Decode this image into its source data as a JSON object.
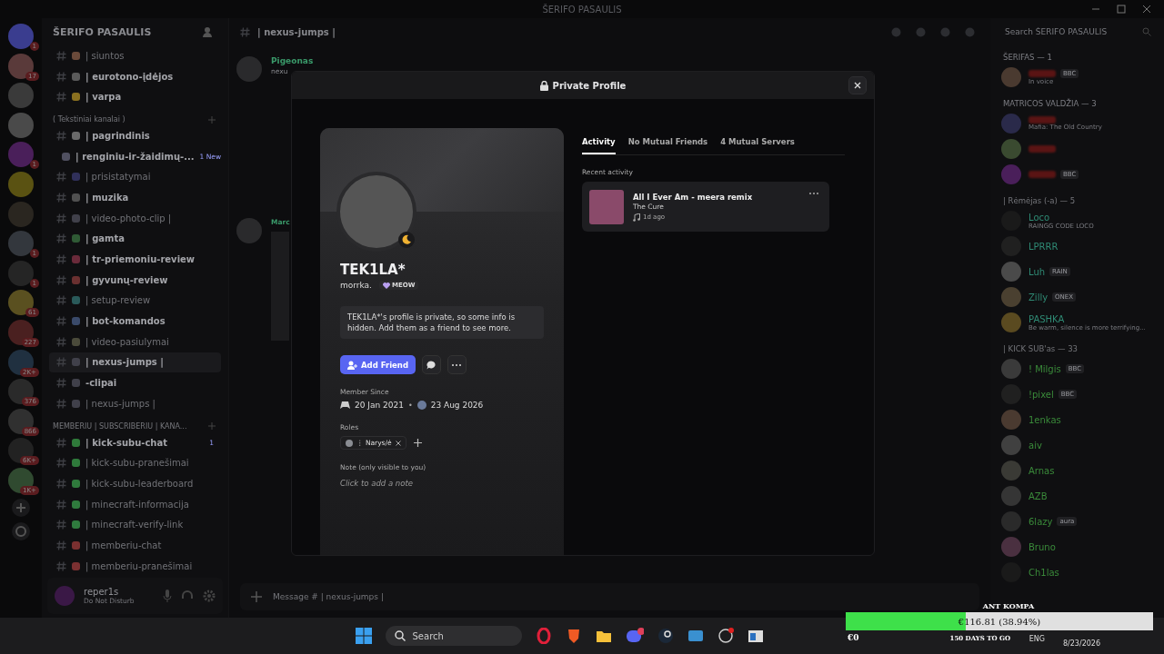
{
  "window": {
    "title": "ŠERIFO PASAULIS"
  },
  "server": {
    "name": "ŠERIFO PASAULIS"
  },
  "servers": [
    {
      "badge": "1",
      "color": "#3a3d8f"
    },
    {
      "badge": "17",
      "color": "#5a3a3a"
    },
    {
      "color": "#3a3a3a"
    },
    {
      "color": "#4a4a4a"
    },
    {
      "badge": "1",
      "color": "#4a1f5a"
    },
    {
      "color": "#5a5212"
    },
    {
      "color": "#2a2620"
    },
    {
      "badge": "1",
      "color": "#33373d"
    },
    {
      "badge": "1",
      "color": "#252525"
    },
    {
      "badge": "61",
      "color": "#5a5020"
    },
    {
      "badge": "227",
      "color": "#4a2020"
    },
    {
      "badge": "2K+",
      "color": "#203040"
    },
    {
      "badge": "376",
      "color": "#2a2a2a"
    },
    {
      "badge": "866",
      "color": "#303030"
    },
    {
      "badge": "6K+",
      "color": "#222222"
    },
    {
      "badge": "1K+",
      "color": "#304a30"
    }
  ],
  "sections": [
    {
      "channels": [
        {
          "name": "| siuntos",
          "unread": false,
          "selected": false,
          "color": "#6a4a3a"
        },
        {
          "name": "| eurotono-įdėjos",
          "unread": true,
          "selected": false,
          "color": "#5a5a5a"
        },
        {
          "name": "| varpa",
          "unread": true,
          "selected": false,
          "color": "#8a7020"
        }
      ]
    },
    {
      "title": "( Tekstiniai kanalai )",
      "channels": [
        {
          "name": "| pagrindinis",
          "unread": true,
          "selected": false,
          "color": "#6a6a6a"
        },
        {
          "name": "| renginiu-ir-žaidimų-...",
          "unread": true,
          "selected": false,
          "color": "#505060",
          "badge": "1 New"
        },
        {
          "name": "| prisistatymai",
          "unread": false,
          "selected": false,
          "color": "#30305a"
        },
        {
          "name": "| muzika",
          "unread": true,
          "selected": false,
          "color": "#505050"
        },
        {
          "name": "| video-photo-clip |",
          "unread": false,
          "selected": false,
          "color": "#40404a"
        },
        {
          "name": "| gamta",
          "unread": true,
          "selected": false,
          "color": "#2f5a35"
        },
        {
          "name": "| tr-priemoniu-review",
          "unread": true,
          "selected": false,
          "color": "#6a2a3a"
        },
        {
          "name": "| gyvunų-review",
          "unread": true,
          "selected": false,
          "color": "#6a3030"
        },
        {
          "name": "| setup-review",
          "unread": false,
          "selected": false,
          "color": "#2a5a5a"
        },
        {
          "name": "| bot-komandos",
          "unread": true,
          "selected": false,
          "color": "#3a4a6a"
        },
        {
          "name": "| video-pasiulymai",
          "unread": false,
          "selected": false,
          "color": "#4a4a3a"
        },
        {
          "name": "| nexus-jumps |",
          "unread": true,
          "selected": true,
          "color": "#40404a"
        },
        {
          "name": "-clipai",
          "unread": true,
          "selected": false,
          "color": "#40404a"
        },
        {
          "name": "| nexus-jumps |",
          "unread": false,
          "selected": false,
          "color": "#40404a"
        }
      ]
    },
    {
      "title": "MEMBERIU | SUBSCRIBERIU | KANA...",
      "channels": [
        {
          "name": "| kick-subu-chat",
          "unread": true,
          "selected": false,
          "color": "#2f7a3a",
          "badge": "1"
        },
        {
          "name": "| kick-subu-pranešimai",
          "unread": false,
          "selected": false,
          "color": "#2f7a3b"
        },
        {
          "name": "| kick-subu-leaderboard",
          "unread": false,
          "selected": false,
          "color": "#2f7a3c"
        },
        {
          "name": "| minecraft-informacija",
          "unread": false,
          "selected": false,
          "color": "#2f7a3d"
        },
        {
          "name": "| minecraft-verify-link",
          "unread": false,
          "selected": false,
          "color": "#2f7a3e"
        },
        {
          "name": "| memberiu-chat",
          "unread": false,
          "selected": false,
          "color": "#7a3030"
        },
        {
          "name": "| memberiu-pranešimai",
          "unread": false,
          "selected": false,
          "color": "#7a3031"
        }
      ]
    }
  ],
  "user": {
    "name": "reper1s",
    "status": "Do Not Disturb"
  },
  "chat": {
    "channel": "| nexus-jumps |",
    "messages": [
      {
        "author": "Pigeonas",
        "text": "nexu"
      },
      {
        "author": "Marc"
      }
    ],
    "placeholder": "Message # | nexus-jumps |"
  },
  "members": {
    "search_placeholder": "Search ŠERIFO PASAULIS",
    "groups": [
      {
        "title": "ŠERIFAS — 1",
        "kind": "staff",
        "members": [
          {
            "redacted": true,
            "tag": "BBC",
            "status": "In voice",
            "color": "#4a3a30"
          }
        ]
      },
      {
        "title": "MATRICOS VALDŽIA — 3",
        "kind": "staff",
        "members": [
          {
            "redacted": true,
            "status": "Mafia: The Old Country",
            "color": "#2a2a4a"
          },
          {
            "redacted": true,
            "color": "#3a4a30"
          },
          {
            "redacted": true,
            "tag": "BBC",
            "color": "#4a1f5a"
          }
        ]
      },
      {
        "title": "| Rėmėjas (-a) — 5",
        "kind": "supporter",
        "members": [
          {
            "name": "Loco",
            "redacted": false,
            "status": "RAINGG CODE LOCO",
            "color": "#1a1a1a"
          },
          {
            "name": "LPRRR",
            "redacted": false,
            "color": "#202020"
          },
          {
            "name": "Luh",
            "redacted": false,
            "tag": "RAIN",
            "color": "#4a4a4a"
          },
          {
            "name": "Zilly",
            "redacted": false,
            "tag": "ONEX",
            "color": "#4a4030"
          },
          {
            "name": "PASHKA",
            "redacted": false,
            "status": "Be warm, silence is more terrifying...",
            "color": "#5a4a20"
          }
        ]
      },
      {
        "title": "| KICK SUB'as — 33",
        "kind": "subscriber",
        "members": [
          {
            "name": "! Milgis",
            "redacted": false,
            "tag": "BBC",
            "color": "#3a3a3a"
          },
          {
            "name": "!pixel",
            "redacted": false,
            "tag": "BBC",
            "color": "#202020"
          },
          {
            "name": "1enkas",
            "redacted": false,
            "color": "#4a3a30"
          },
          {
            "name": "aiv",
            "redacted": false,
            "color": "#404040"
          },
          {
            "name": "Arnas",
            "redacted": false,
            "color": "#3a3a35"
          },
          {
            "name": "AZB",
            "redacted": false,
            "color": "#353535"
          },
          {
            "name": "6lazy",
            "redacted": false,
            "tag": "aura",
            "color": "#2a2a2a"
          },
          {
            "name": "Bruno",
            "redacted": false,
            "color": "#4a3040"
          },
          {
            "name": "Ch1las",
            "redacted": false,
            "color": "#1a1a1a"
          }
        ]
      }
    ]
  },
  "profile": {
    "title": "Private Profile",
    "display_name": "TEK1LA*",
    "username": "morrka.",
    "tag": "MEOW",
    "notice": "TEK1LA*'s profile is private, so some info is hidden. Add them as a friend to see more.",
    "add_friend": "Add Friend",
    "member_since_label": "Member Since",
    "discord_since": "20 Jan 2021",
    "separator": "•",
    "server_since": "23 Aug 2026",
    "roles_label": "Roles",
    "roles": [
      {
        "name": "⋮ Narys/ė",
        "color": "#8a8d93"
      }
    ],
    "note_label": "Note (only visible to you)",
    "note_placeholder": "Click to add a note",
    "tabs": [
      {
        "label": "Activity",
        "selected": true
      },
      {
        "label": "No Mutual Friends",
        "selected": false
      },
      {
        "label": "4 Mutual Servers",
        "selected": false
      }
    ],
    "recent_label": "Recent activity",
    "activity": {
      "title": "All I Ever Am - meera remix",
      "artist": "The Cure",
      "time": "1d ago"
    }
  },
  "taskbar": {
    "search": "Search",
    "language": "ENG",
    "date": "8/23/2026"
  },
  "goal": {
    "title": "ANT KOMPA",
    "amount": "€116.81 (38.94%)",
    "level": 0.3894,
    "start": "€0",
    "remaining": "150 DAYS TO GO"
  }
}
